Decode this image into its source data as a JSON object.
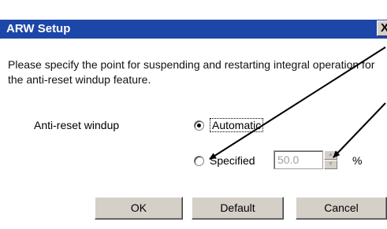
{
  "window": {
    "title": "ARW Setup",
    "close_glyph": "X"
  },
  "description": "Please specify the point for suspending and restarting integral operation for the anti-reset windup feature.",
  "setting": {
    "label": "Anti-reset windup",
    "options": [
      {
        "label": "Automatic",
        "selected": true
      },
      {
        "label": "Specified",
        "selected": false
      }
    ],
    "value": "50.0",
    "unit": "%",
    "value_enabled": false
  },
  "buttons": {
    "ok": "OK",
    "default": "Default",
    "cancel": "Cancel"
  },
  "annotation": {
    "arrow_color": "#000000",
    "arrow_count": 2
  }
}
